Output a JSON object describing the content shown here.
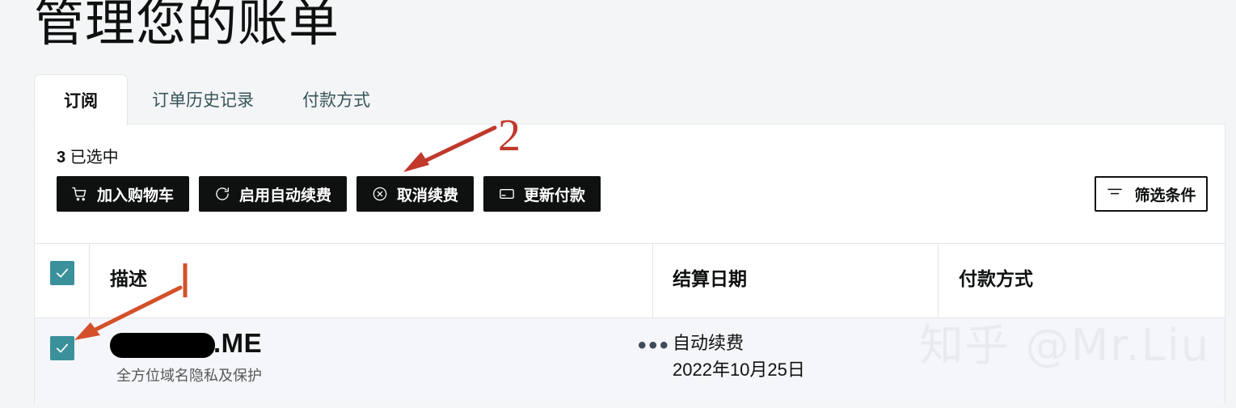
{
  "page": {
    "title": "管理您的账单",
    "background_color": "#f4f5f7"
  },
  "tabs": [
    {
      "label": "订阅",
      "active": true,
      "name": "tab-subscriptions"
    },
    {
      "label": "订单历史记录",
      "active": false,
      "name": "tab-order-history"
    },
    {
      "label": "付款方式",
      "active": false,
      "name": "tab-payment-methods"
    }
  ],
  "toolbar": {
    "selected_count_number": "3",
    "selected_count_label": " 已选中",
    "buttons": [
      {
        "label": "加入购物车",
        "icon": "shopping-cart-icon"
      },
      {
        "label": "启用自动续费",
        "icon": "refresh-icon"
      },
      {
        "label": "取消续费",
        "icon": "circle-x-icon"
      },
      {
        "label": "更新付款",
        "icon": "credit-card-icon"
      }
    ],
    "filter": {
      "label": "筛选条件",
      "icon": "filter-icon"
    }
  },
  "table": {
    "headers": {
      "description": "描述",
      "billing_date": "结算日期",
      "payment_method": "付款方式"
    },
    "header_checkbox_checked": true,
    "rows": [
      {
        "checked": true,
        "domain_redacted": true,
        "domain_suffix": ".ME",
        "description_sub": "全方位域名隐私及保护",
        "row_menu": "•••",
        "billing_status": "自动续费",
        "billing_date": "2022年10月25日"
      }
    ]
  },
  "annotations": {
    "step_number": "2",
    "accent_color": "#c0392b",
    "checkbox_color": "#3a919b"
  },
  "watermark": {
    "text": "知乎 @Mr.Liu"
  }
}
